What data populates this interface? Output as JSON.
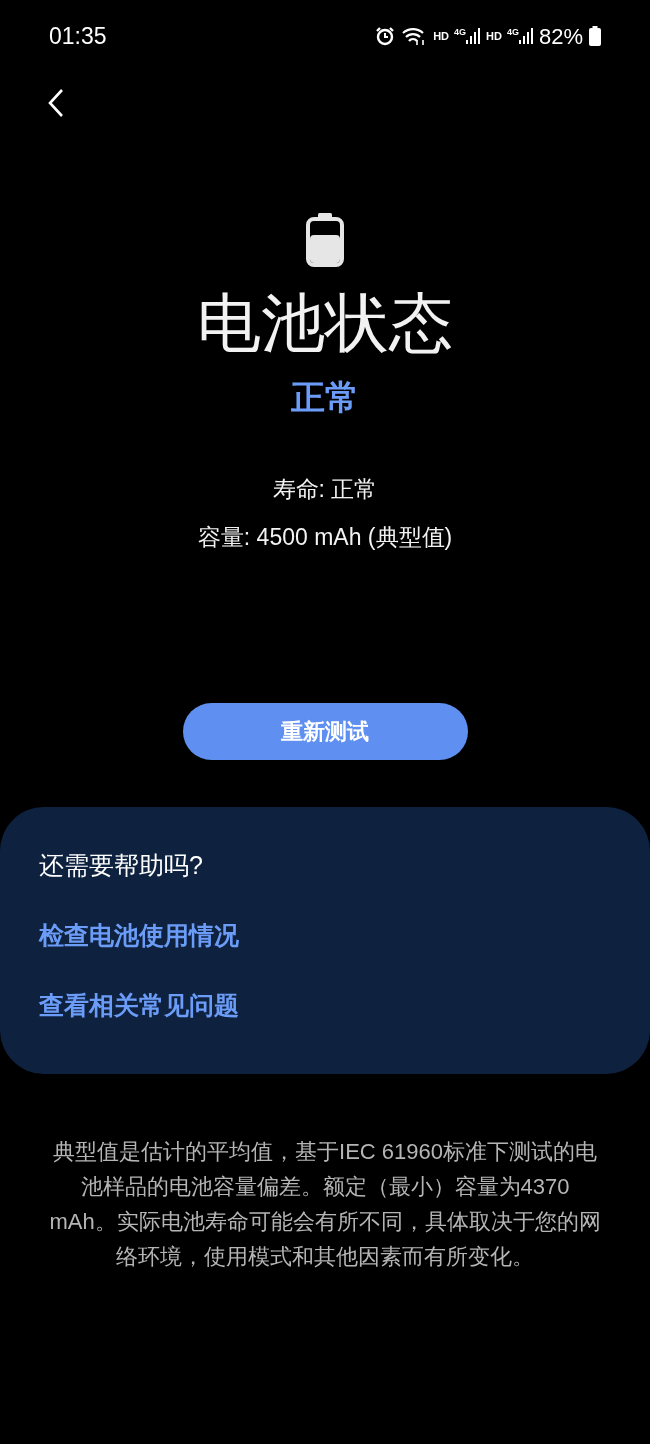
{
  "status_bar": {
    "time": "01:35",
    "sim_labels": [
      {
        "hd": "HD",
        "network": "4G"
      },
      {
        "hd": "HD",
        "network": "4G"
      }
    ],
    "battery_percent": "82%"
  },
  "status": {
    "title": "电池状态",
    "result": "正常",
    "details": [
      "寿命: 正常",
      "容量: 4500 mAh (典型值)"
    ]
  },
  "retest_button": "重新测试",
  "help_card": {
    "heading": "还需要帮助吗?",
    "links": [
      "检查电池使用情况",
      "查看相关常见问题"
    ]
  },
  "footnote": "典型值是估计的平均值，基于IEC 61960标准下测试的电池样品的电池容量偏差。额定（最小）容量为4370 mAh。实际电池寿命可能会有所不同，具体取决于您的网络环境，使用模式和其他因素而有所变化。"
}
